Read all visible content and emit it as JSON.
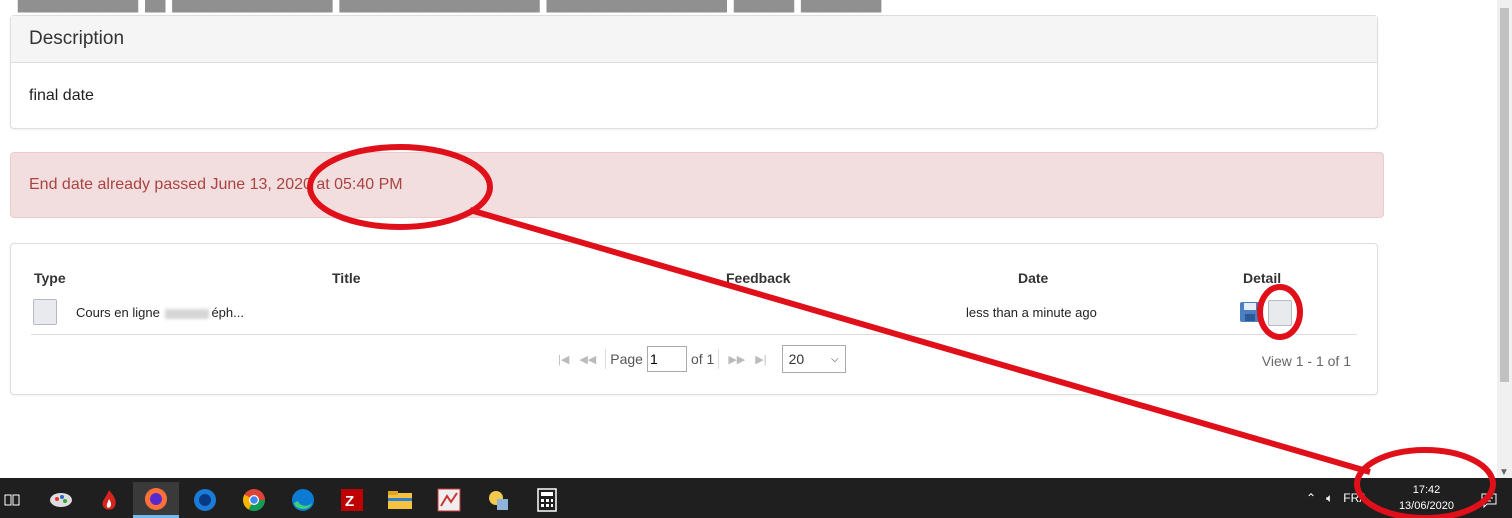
{
  "description": {
    "header": "Description",
    "body": "final date"
  },
  "alert": {
    "text": "End date already passed June 13, 2020 at 05:40 PM"
  },
  "table": {
    "columns": [
      "Type",
      "Title",
      "Feedback",
      "Date",
      "Detail"
    ],
    "rows": [
      {
        "title": "Cours en ligne",
        "title_suffix": "éph...",
        "date": "less than a minute ago"
      }
    ]
  },
  "pager": {
    "page_label": "Page",
    "page_value": "1",
    "of_label": "of 1",
    "page_size": "20",
    "view_info": "View 1 - 1 of 1"
  },
  "taskbar": {
    "language": "FRA",
    "time": "17:42",
    "date": "13/06/2020"
  },
  "colors": {
    "alert_bg": "#f2dede",
    "alert_text": "#a94442",
    "annotation": "#e0101a",
    "taskbar": "#1f1f1f"
  }
}
